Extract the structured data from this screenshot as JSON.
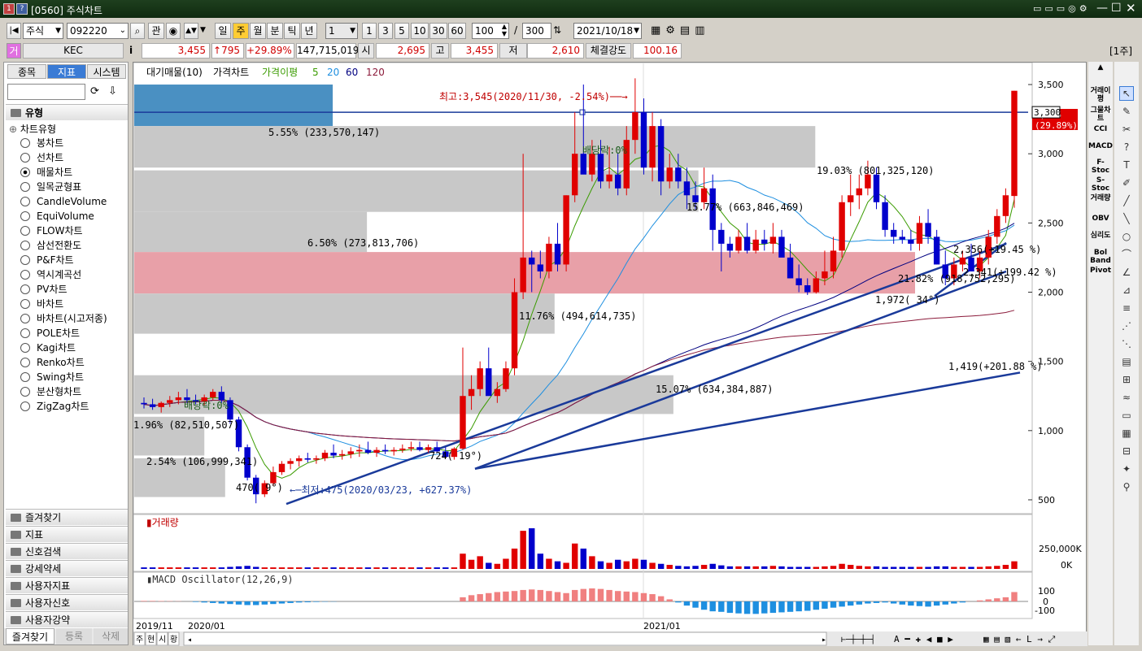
{
  "window": {
    "badge1": "1",
    "badge2": "?",
    "title": "[0560] 주식차트"
  },
  "toolbar": {
    "market": "주식",
    "code": "092220",
    "gwan": "관",
    "periods": [
      "일",
      "주",
      "월",
      "분",
      "틱",
      "년"
    ],
    "tick_value": "1",
    "tick_opts": [
      "1",
      "3",
      "5",
      "10",
      "30",
      "60"
    ],
    "count": "100",
    "total": "300",
    "slash": "/",
    "date": "2021/10/18",
    "week_tag": "[1주]"
  },
  "quote": {
    "tag": "거",
    "name": "KEC",
    "info": "i",
    "price": "3,455",
    "change": "↑795",
    "rate": "+29.89%",
    "volume": "147,715,019",
    "open_label": "시",
    "open": "2,695",
    "high_label": "고",
    "high": "3,455",
    "low_label": "저",
    "low": "2,610",
    "strength_label": "체결강도",
    "strength": "100.16"
  },
  "left": {
    "tabs": [
      "종목",
      "지표",
      "시스템"
    ],
    "section": "유형",
    "group": "차트유형",
    "items": [
      "봉차트",
      "선차트",
      "매물차트",
      "일목균형표",
      "CandleVolume",
      "EquiVolume",
      "FLOW차트",
      "삼선전환도",
      "P&F차트",
      "역시계곡선",
      "PV차트",
      "바차트",
      "바차트(시고저종)",
      "POLE차트",
      "Kagi차트",
      "Renko차트",
      "Swing차트",
      "분산형차트",
      "ZigZag차트"
    ],
    "selected_index": 2,
    "sections": [
      "즐겨찾기",
      "지표",
      "신호검색",
      "강세약세",
      "사용자지표",
      "사용자신호",
      "사용자강약"
    ],
    "bottom": [
      "즐겨찾기",
      "등록",
      "삭제"
    ]
  },
  "chart": {
    "legend": [
      "대기매물(10)",
      "가격차트",
      "가격이평",
      "5",
      "20",
      "60",
      "120"
    ],
    "legend_colors": {
      "ma5": "#3a9b00",
      "ma20": "#1e8fe0",
      "ma60": "#000080",
      "ma120": "#8b1a3a"
    },
    "axis_labels": [
      "3,500",
      "3,000",
      "2,500",
      "2,000",
      "1,500",
      "1,000",
      "500"
    ],
    "price_tag": "3,455",
    "price_tag_pct": "(29.89%)",
    "line_tag": "3,300",
    "volume_profile": [
      {
        "label": "5.55% (233,570,147)",
        "value": 233570147,
        "low": 3200,
        "high": 3500,
        "color": "#4a90c2"
      },
      {
        "label": "19.03% (801,325,120)",
        "value": 801325120,
        "low": 2900,
        "high": 3200,
        "color": "#c8c8c8"
      },
      {
        "label": "15.77% (663,846,469)",
        "value": 663846469,
        "low": 2580,
        "high": 2880,
        "color": "#c8c8c8"
      },
      {
        "label": "6.50% (273,813,706)",
        "value": 273813706,
        "low": 2290,
        "high": 2580,
        "color": "#c8c8c8"
      },
      {
        "label": "21.82% (918,752,295)",
        "value": 918752295,
        "low": 1990,
        "high": 2290,
        "color": "#e8a0a8"
      },
      {
        "label": "11.76% (494,614,735)",
        "value": 494614735,
        "low": 1700,
        "high": 1990,
        "color": "#c8c8c8"
      },
      {
        "label": "15.07% (634,384,887)",
        "value": 634384887,
        "low": 1120,
        "high": 1400,
        "color": "#c8c8c8"
      },
      {
        "label": "1.96% (82,510,507)",
        "value": 82510507,
        "low": 820,
        "high": 1100,
        "color": "#c8c8c8"
      },
      {
        "label": "2.54% (106,999,341)",
        "value": 106999341,
        "low": 520,
        "high": 800,
        "color": "#c8c8c8"
      }
    ],
    "annotations": {
      "max": "최고:3,545(2020/11/30, -2.54%)",
      "min": "최저:475(2020/03/23, +627.37%)",
      "div1": "배당락:0%",
      "div2": "배당락:0%",
      "t1": "470(  9°)",
      "t2": "724( 19°)",
      "t3": "1,972( 34°)",
      "t4": "2,356(+19.45 %)",
      "t5": "2,341(+199.42 %)",
      "t6": "1,419(+201.88 %)"
    },
    "volume_title": "거래량",
    "volume_axis": [
      "250,000K",
      "0K"
    ],
    "macd_title": "MACD Oscillator(12,26,9)",
    "macd_axis": [
      "100",
      "0",
      "-100"
    ],
    "dates": [
      "2019/11",
      "2020/01",
      "2021/01"
    ],
    "bottom_tabs": [
      "주",
      "현",
      "시",
      "황"
    ]
  },
  "indicators": [
    "거래이평",
    "그물차트",
    "CCI",
    "MACD",
    "F-Stoc",
    "S-Stoc",
    "거래량",
    "OBV",
    "심리도",
    "Bol Band",
    "Pivot"
  ],
  "chart_data": {
    "type": "candlestick",
    "period": "weekly",
    "x_dates": [
      "2019/11",
      "2020/01",
      "2021/01"
    ],
    "ylim": [
      400,
      3600
    ],
    "candles": [
      [
        1200,
        1240,
        1160,
        1190
      ],
      [
        1190,
        1230,
        1150,
        1170
      ],
      [
        1170,
        1210,
        1130,
        1200
      ],
      [
        1200,
        1250,
        1170,
        1220
      ],
      [
        1220,
        1280,
        1190,
        1240
      ],
      [
        1240,
        1300,
        1200,
        1220
      ],
      [
        1220,
        1260,
        1190,
        1210
      ],
      [
        1210,
        1260,
        1180,
        1240
      ],
      [
        1240,
        1300,
        1220,
        1280
      ],
      [
        1280,
        1320,
        1200,
        1220
      ],
      [
        1220,
        1240,
        1050,
        1080
      ],
      [
        1080,
        1100,
        850,
        880
      ],
      [
        880,
        900,
        640,
        660
      ],
      [
        660,
        680,
        475,
        540
      ],
      [
        540,
        640,
        520,
        620
      ],
      [
        620,
        740,
        600,
        700
      ],
      [
        700,
        780,
        680,
        760
      ],
      [
        760,
        800,
        720,
        780
      ],
      [
        780,
        820,
        740,
        800
      ],
      [
        800,
        840,
        770,
        790
      ],
      [
        790,
        820,
        760,
        800
      ],
      [
        800,
        860,
        780,
        840
      ],
      [
        840,
        900,
        800,
        820
      ],
      [
        820,
        860,
        790,
        830
      ],
      [
        830,
        880,
        800,
        850
      ],
      [
        850,
        900,
        810,
        860
      ],
      [
        860,
        920,
        830,
        840
      ],
      [
        840,
        880,
        810,
        860
      ],
      [
        860,
        900,
        830,
        850
      ],
      [
        850,
        880,
        820,
        860
      ],
      [
        860,
        900,
        840,
        870
      ],
      [
        870,
        920,
        850,
        880
      ],
      [
        880,
        920,
        850,
        860
      ],
      [
        860,
        900,
        840,
        880
      ],
      [
        880,
        920,
        840,
        850
      ],
      [
        850,
        880,
        800,
        810
      ],
      [
        810,
        880,
        790,
        870
      ],
      [
        870,
        1600,
        860,
        1250
      ],
      [
        1250,
        1400,
        1150,
        1300
      ],
      [
        1300,
        1500,
        1250,
        1450
      ],
      [
        1450,
        1600,
        1400,
        1250
      ],
      [
        1250,
        1350,
        1200,
        1300
      ],
      [
        1300,
        1500,
        1280,
        1450
      ],
      [
        1450,
        2100,
        1400,
        2000
      ],
      [
        2000,
        3000,
        1950,
        2250
      ],
      [
        2250,
        2300,
        2000,
        2200
      ],
      [
        2200,
        2300,
        2100,
        2150
      ],
      [
        2150,
        2400,
        2100,
        2350
      ],
      [
        2350,
        2500,
        2150,
        2200
      ],
      [
        2200,
        2700,
        2150,
        2700
      ],
      [
        2700,
        3300,
        2650,
        3000
      ],
      [
        3000,
        3500,
        2900,
        2850
      ],
      [
        2850,
        3100,
        2800,
        3000
      ],
      [
        3000,
        3100,
        2750,
        2800
      ],
      [
        2800,
        3050,
        2750,
        2850
      ],
      [
        2850,
        3000,
        2700,
        2750
      ],
      [
        2750,
        3200,
        2700,
        3100
      ],
      [
        3100,
        3545,
        3000,
        3300
      ],
      [
        3300,
        3400,
        2850,
        2900
      ],
      [
        2900,
        3300,
        2800,
        3200
      ],
      [
        3200,
        3250,
        2700,
        2800
      ],
      [
        2800,
        3000,
        2750,
        2900
      ],
      [
        2900,
        3000,
        2750,
        2800
      ],
      [
        2800,
        2900,
        2600,
        2700
      ],
      [
        2700,
        2800,
        2600,
        2650
      ],
      [
        2650,
        2900,
        2600,
        2750
      ],
      [
        2750,
        2850,
        2300,
        2450
      ],
      [
        2450,
        2500,
        2150,
        2350
      ],
      [
        2350,
        2400,
        2250,
        2300
      ],
      [
        2300,
        2450,
        2280,
        2400
      ],
      [
        2400,
        2500,
        2280,
        2300
      ],
      [
        2300,
        2450,
        2280,
        2380
      ],
      [
        2380,
        2450,
        2300,
        2350
      ],
      [
        2350,
        2500,
        2280,
        2400
      ],
      [
        2400,
        2450,
        2300,
        2250
      ],
      [
        2250,
        2350,
        2100,
        2100
      ],
      [
        2100,
        2200,
        2000,
        2050
      ],
      [
        2050,
        2100,
        1980,
        2000
      ],
      [
        2000,
        2150,
        1990,
        2100
      ],
      [
        2100,
        2300,
        2050,
        2150
      ],
      [
        2150,
        2400,
        2100,
        2300
      ],
      [
        2300,
        2700,
        2250,
        2650
      ],
      [
        2650,
        2850,
        2550,
        2700
      ],
      [
        2700,
        2850,
        2600,
        2750
      ],
      [
        2750,
        2950,
        2700,
        2850
      ],
      [
        2850,
        2900,
        2600,
        2650
      ],
      [
        2650,
        2700,
        2400,
        2450
      ],
      [
        2450,
        2500,
        2350,
        2400
      ],
      [
        2400,
        2450,
        2350,
        2380
      ],
      [
        2380,
        2450,
        2300,
        2350
      ],
      [
        2350,
        2550,
        2300,
        2500
      ],
      [
        2500,
        2600,
        2350,
        2400
      ],
      [
        2400,
        2450,
        2200,
        2200
      ],
      [
        2200,
        2300,
        2050,
        2100
      ],
      [
        2100,
        2250,
        2050,
        2200
      ],
      [
        2200,
        2300,
        2150,
        2250
      ],
      [
        2250,
        2350,
        2150,
        2150
      ],
      [
        2150,
        2300,
        2100,
        2250
      ],
      [
        2250,
        2450,
        2200,
        2400
      ],
      [
        2400,
        2600,
        2350,
        2550
      ],
      [
        2550,
        2750,
        2500,
        2700
      ],
      [
        2695,
        3455,
        2610,
        3455
      ]
    ],
    "volume": [
      3,
      3,
      3,
      3,
      3,
      3,
      3,
      3,
      3,
      3,
      4,
      5,
      6,
      4,
      3,
      3,
      3,
      3,
      3,
      3,
      3,
      3,
      3,
      3,
      3,
      3,
      3,
      3,
      3,
      3,
      3,
      3,
      3,
      3,
      3,
      3,
      3,
      30,
      18,
      25,
      12,
      10,
      20,
      40,
      75,
      80,
      30,
      20,
      15,
      12,
      50,
      40,
      25,
      15,
      12,
      18,
      15,
      20,
      18,
      12,
      10,
      8,
      6,
      5,
      6,
      8,
      10,
      7,
      5,
      5,
      5,
      5,
      5,
      6,
      5,
      4,
      4,
      4,
      4,
      5,
      6,
      10,
      8,
      6,
      5,
      5,
      4,
      4,
      4,
      4,
      4,
      4,
      5,
      5,
      4,
      4,
      4,
      4,
      5,
      6,
      8,
      15
    ],
    "volume_unit": "thousand shares (scaled)",
    "macd": [
      5,
      5,
      4,
      3,
      2,
      0,
      -5,
      -10,
      -15,
      -20,
      -25,
      -30,
      -35,
      -35,
      -30,
      -25,
      -20,
      -15,
      -10,
      -8,
      -5,
      -3,
      -2,
      0,
      0,
      0,
      0,
      0,
      0,
      0,
      0,
      0,
      0,
      0,
      0,
      0,
      0,
      40,
      60,
      70,
      80,
      90,
      95,
      100,
      110,
      115,
      110,
      100,
      90,
      80,
      110,
      120,
      125,
      120,
      110,
      100,
      95,
      90,
      80,
      70,
      50,
      20,
      -10,
      -40,
      -60,
      -80,
      -95,
      -100,
      -110,
      -115,
      -120,
      -120,
      -115,
      -110,
      -105,
      -100,
      -95,
      -90,
      -80,
      -70,
      -60,
      -50,
      -40,
      -30,
      -20,
      -15,
      -10,
      -20,
      -30,
      -40,
      -45,
      -50,
      -40,
      -30,
      -20,
      -10,
      0,
      10,
      20,
      30,
      40,
      90
    ]
  }
}
